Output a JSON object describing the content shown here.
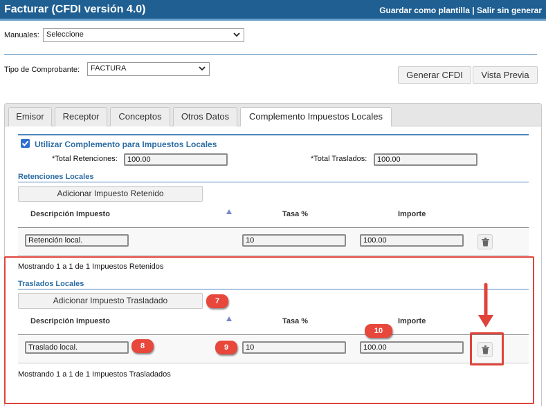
{
  "header": {
    "title": "Facturar (CFDI versión 4.0)",
    "save_template": "Guardar como plantilla",
    "separator": "|",
    "exit_link": "Salir sin generar"
  },
  "manuales": {
    "label": "Manuales:",
    "value": "Seleccione"
  },
  "tipo_comprobante": {
    "label": "Tipo de Comprobante:",
    "value": "FACTURA"
  },
  "actions": {
    "generate": "Generar CFDI",
    "preview": "Vista Previa"
  },
  "tabs": [
    {
      "label": "Emisor"
    },
    {
      "label": "Receptor"
    },
    {
      "label": "Conceptos"
    },
    {
      "label": "Otros Datos"
    },
    {
      "label": "Complemento Impuestos Locales",
      "active": true
    }
  ],
  "complemento": {
    "use_label": "Utilizar Complemento para Impuestos Locales",
    "checked": true,
    "total_retenciones_label": "*Total Retenciones:",
    "total_retenciones_value": "100.00",
    "total_traslados_label": "*Total Traslados:",
    "total_traslados_value": "100.00"
  },
  "retenciones": {
    "title": "Retenciones Locales",
    "add_button": "Adicionar Impuesto Retenido",
    "columns": {
      "descripcion": "Descripción Impuesto",
      "tasa": "Tasa %",
      "importe": "Importe"
    },
    "rows": [
      {
        "descripcion": "Retención local.",
        "tasa": "10",
        "importe": "100.00"
      }
    ],
    "footer": "Mostrando 1 a 1 de 1 Impuestos Retenidos"
  },
  "traslados": {
    "title": "Traslados Locales",
    "add_button": "Adicionar Impuesto Trasladado",
    "columns": {
      "descripcion": "Descripción Impuesto",
      "tasa": "Tasa %",
      "importe": "Importe"
    },
    "rows": [
      {
        "descripcion": "Traslado local.",
        "tasa": "10",
        "importe": "100.00"
      }
    ],
    "footer": "Mostrando 1 a 1 de 1 Impuestos Trasladados"
  },
  "annotations": {
    "badge_7": "7",
    "badge_8": "8",
    "badge_9": "9",
    "badge_10": "10"
  },
  "colors": {
    "header_bg": "#1f5f92",
    "accent_blue": "#2c6da4",
    "annotation_red": "#e0433a"
  },
  "icons": {
    "checkbox": "checkbox-checked-icon",
    "sort": "sort-up-icon",
    "trash": "trash-icon",
    "dropdown": "chevron-down-icon"
  }
}
